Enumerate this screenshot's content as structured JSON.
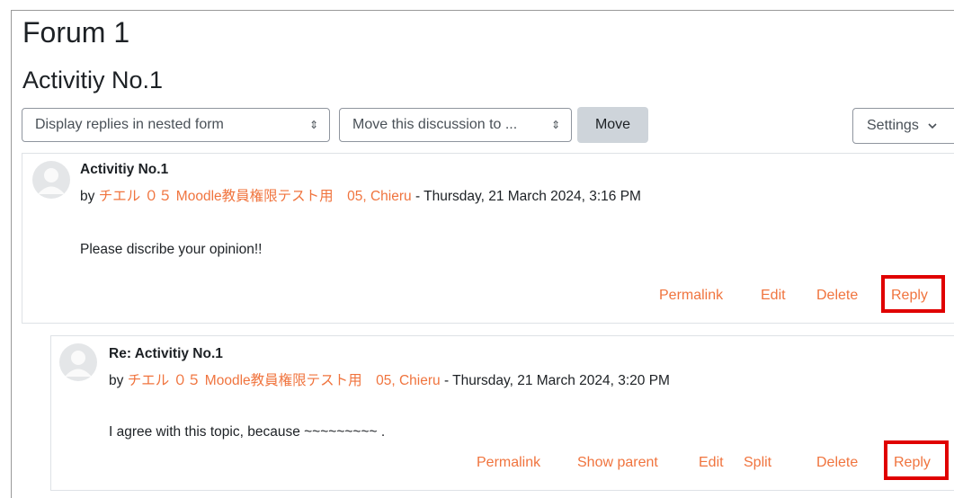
{
  "forum": {
    "title": "Forum 1",
    "discussion_title": "Activitiy No.1"
  },
  "controls": {
    "display_mode": "Display replies in nested form",
    "move_select": "Move this discussion to ...",
    "move_button": "Move",
    "settings_button": "Settings"
  },
  "posts": [
    {
      "subject": "Activitiy No.1",
      "by": "by ",
      "author": "チエル ０５ Moodle教員権限テスト用　05, Chieru",
      "date": " - Thursday, 21 March 2024, 3:16 PM",
      "body": "Please discribe your opinion!!",
      "actions": {
        "permalink": "Permalink",
        "edit": "Edit",
        "delete": "Delete",
        "reply": "Reply"
      }
    },
    {
      "subject": "Re: Activitiy No.1",
      "by": "by ",
      "author": "チエル ０５ Moodle教員権限テスト用　05, Chieru",
      "date": " - Thursday, 21 March 2024, 3:20 PM",
      "body": "I agree with this topic, because ~~~~~~~~~ .",
      "actions": {
        "permalink": "Permalink",
        "show_parent": "Show parent",
        "edit": "Edit",
        "split": "Split",
        "delete": "Delete",
        "reply": "Reply"
      }
    }
  ],
  "icons": {
    "select_arrow": "select-arrows-icon",
    "settings_chevron": "chevron-down-icon",
    "avatar": "default-user-avatar-icon"
  },
  "colors": {
    "link": "#f0743e",
    "highlight": "#e00000",
    "button_secondary": "#ced4da"
  }
}
